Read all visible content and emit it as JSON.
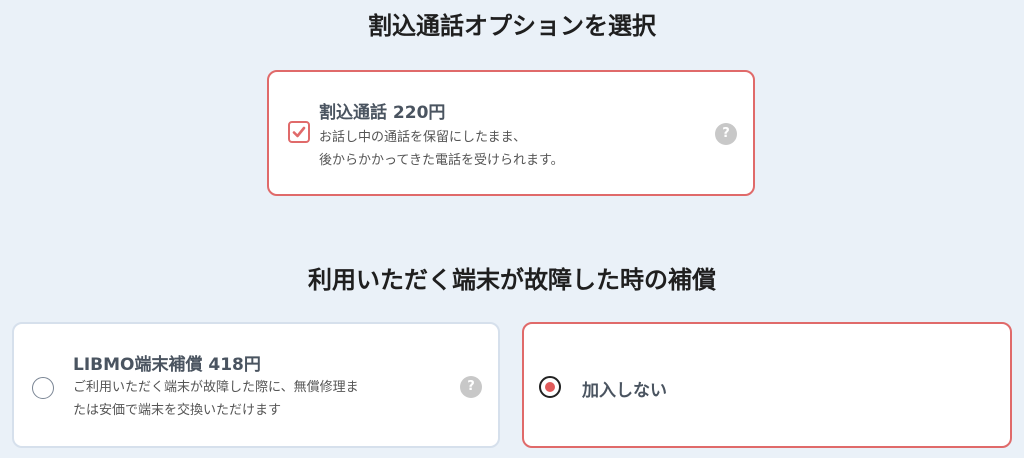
{
  "sections": {
    "call_option_heading": "割込通話オプションを選択",
    "device_heading": "利用いただく端末が故障した時の補償"
  },
  "call_option": {
    "title": "割込通話  220円",
    "desc_line1": "お話し中の通話を保留にしたまま、",
    "desc_line2": "後からかかってきた電話を受けられます。",
    "checked": true,
    "help": "?"
  },
  "libmo_option": {
    "title": "LIBMO端末補償  418円",
    "desc_line1": "ご利用いただく端末が故障した際に、無償修理ま",
    "desc_line2": "たは安価で端末を交換いただけます",
    "selected": false,
    "help": "?"
  },
  "no_option": {
    "label": "加入しない",
    "selected": true
  },
  "colors": {
    "accent": "#e06a6a",
    "background": "#eaf1f8",
    "radio_dot": "#e05a5a"
  }
}
